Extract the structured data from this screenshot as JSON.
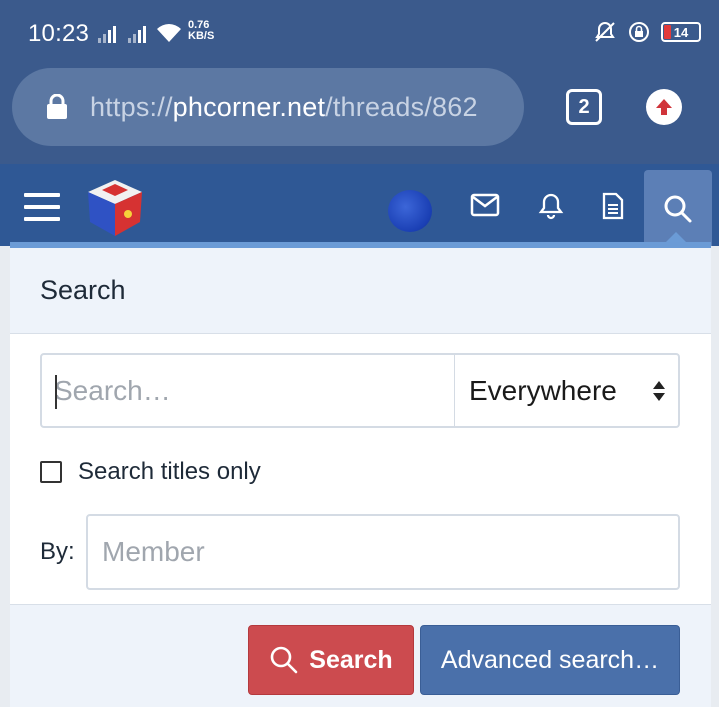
{
  "status_bar": {
    "time": "10:23",
    "speed_value": "0.76",
    "speed_unit": "KB/S",
    "battery": "14"
  },
  "browser": {
    "url_scheme": "https://",
    "url_host": "phcorner.net",
    "url_path": "/threads/862",
    "tab_count": "2"
  },
  "search_panel": {
    "title": "Search",
    "search_placeholder": "Search…",
    "scope_selected": "Everywhere",
    "titles_only_label": "Search titles only",
    "titles_only_checked": false,
    "by_label": "By:",
    "member_placeholder": "Member",
    "search_button": "Search",
    "advanced_button": "Advanced search…"
  },
  "colors": {
    "header_blue": "#2f5895",
    "status_blue": "#3b5a8c",
    "search_button_red": "#cc4b4f",
    "advanced_button_blue": "#4a70aa",
    "panel_accent": "#6b9bd6"
  },
  "icons": [
    "signal-icon",
    "wifi-icon",
    "bell-off-icon",
    "lock-rotation-icon",
    "battery-icon",
    "lock-icon",
    "upload-icon",
    "menu-icon",
    "site-logo",
    "avatar",
    "envelope-icon",
    "bell-icon",
    "document-icon",
    "search-icon",
    "select-arrows-icon"
  ]
}
